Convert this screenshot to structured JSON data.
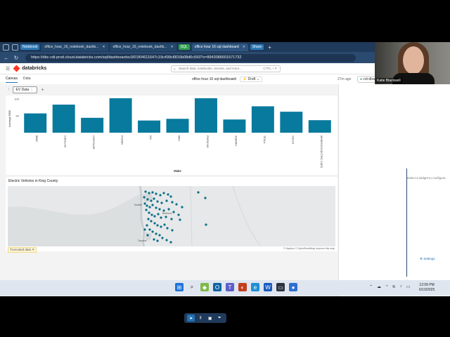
{
  "browser": {
    "tabs": [
      {
        "label": "Notebook",
        "kind": "pill",
        "color": "#2d78b7"
      },
      {
        "label": "office_hour_16_notebook_dashb...",
        "kind": "dark"
      },
      {
        "label": "office_hour_16_notebook_dashb...",
        "kind": "dark"
      },
      {
        "label": "SQL",
        "kind": "pill",
        "color": "#2ea34a"
      },
      {
        "label": "office hour 16 sql dashboard",
        "kind": "active"
      },
      {
        "label": "Share",
        "kind": "pill",
        "color": "#2d78b7"
      }
    ],
    "url": "https://dbc-cdi-prod.cloud.databricks.com/sql/dashboardsv3/01f04611647c19c499c8816b08d6c593?o=8943086601571732"
  },
  "app": {
    "brand": "databricks",
    "search_placeholder": "Search data, notebooks, recents, and more...",
    "search_shortcut": "CTRL + P"
  },
  "dashboard": {
    "tab_canvas": "Canvas",
    "tab_data": "Data",
    "title": "office hour 16 sql dashboard",
    "status": "Draft",
    "edited": "27m ago",
    "compute": "cdi-dbw",
    "filter_label": "EV Data"
  },
  "chart_data": {
    "type": "bar",
    "ylabel": "Average RBE",
    "xlabel": "Make",
    "yticks": [
      "100",
      "50"
    ],
    "categories": [
      "BMW",
      "CADILLAC",
      "CHRYSLER",
      "FISKER",
      "KIA",
      "MINI",
      "PORSCHE",
      "SUBARU",
      "TESLA",
      "VOLVO",
      "WHEEGO ELECTRIC CARS"
    ],
    "values": [
      57,
      83,
      44,
      102,
      36,
      41,
      102,
      39,
      78,
      62,
      37
    ],
    "ylim": [
      0,
      110
    ],
    "color": "#077a9d"
  },
  "map": {
    "title": "Electric Vehicles in King County",
    "truncated": "Truncated data",
    "point_color": "#0a6e86",
    "attribution": "© Mapbox © OpenStreetMap Improve this map",
    "logo": "© Mapbox",
    "places": [
      "Seattle",
      "Bellevue",
      "Tacoma"
    ]
  },
  "right_panel": {
    "message": "Select a widget to configure",
    "settings": "Settings"
  },
  "presenter": {
    "name": "Katie Blackwell"
  },
  "taskbar": {
    "time": "12:09 PM",
    "date": "6/10/2025"
  }
}
